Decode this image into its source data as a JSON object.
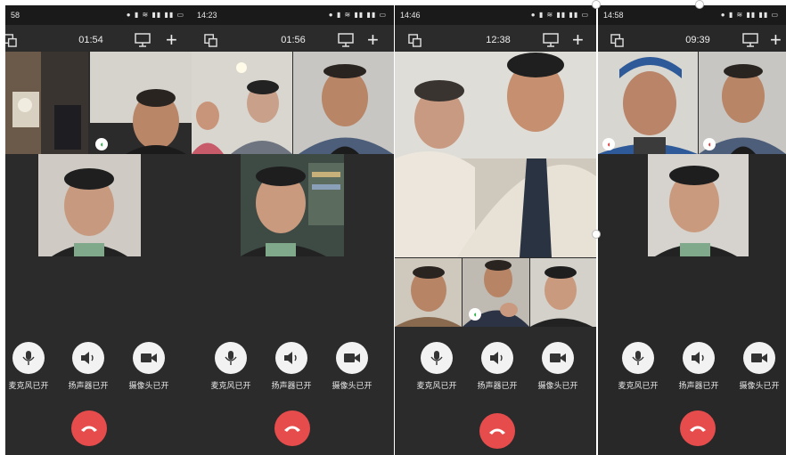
{
  "screens": [
    {
      "status_time": "58",
      "timer": "01:54",
      "controls": {
        "mic": "麦克风已开",
        "speaker": "扬声器已开",
        "camera": "摄像头已开"
      }
    },
    {
      "status_time": "14:23",
      "timer": "01:56",
      "controls": {
        "mic": "麦克风已开",
        "speaker": "扬声器已开",
        "camera": "摄像头已开"
      }
    },
    {
      "status_time": "14:46",
      "timer": "12:38",
      "controls": {
        "mic": "麦克风已开",
        "speaker": "扬声器已开",
        "camera": "摄像头已开"
      }
    },
    {
      "status_time": "14:58",
      "timer": "09:39",
      "controls": {
        "mic": "麦克风已开",
        "speaker": "扬声器已开",
        "camera": "摄像头已开"
      }
    }
  ],
  "colors": {
    "panel_bg": "#2b2b2b",
    "hangup": "#e74c4c",
    "mic_active": "#2fb34a",
    "mic_muted": "#e13b3b"
  },
  "icons": {
    "window": "window-switch-icon",
    "screen": "screen-share-icon",
    "add": "add-participant-icon",
    "mic": "microphone-icon",
    "speaker": "speaker-icon",
    "camera": "camera-icon",
    "hangup": "hang-up-icon"
  }
}
